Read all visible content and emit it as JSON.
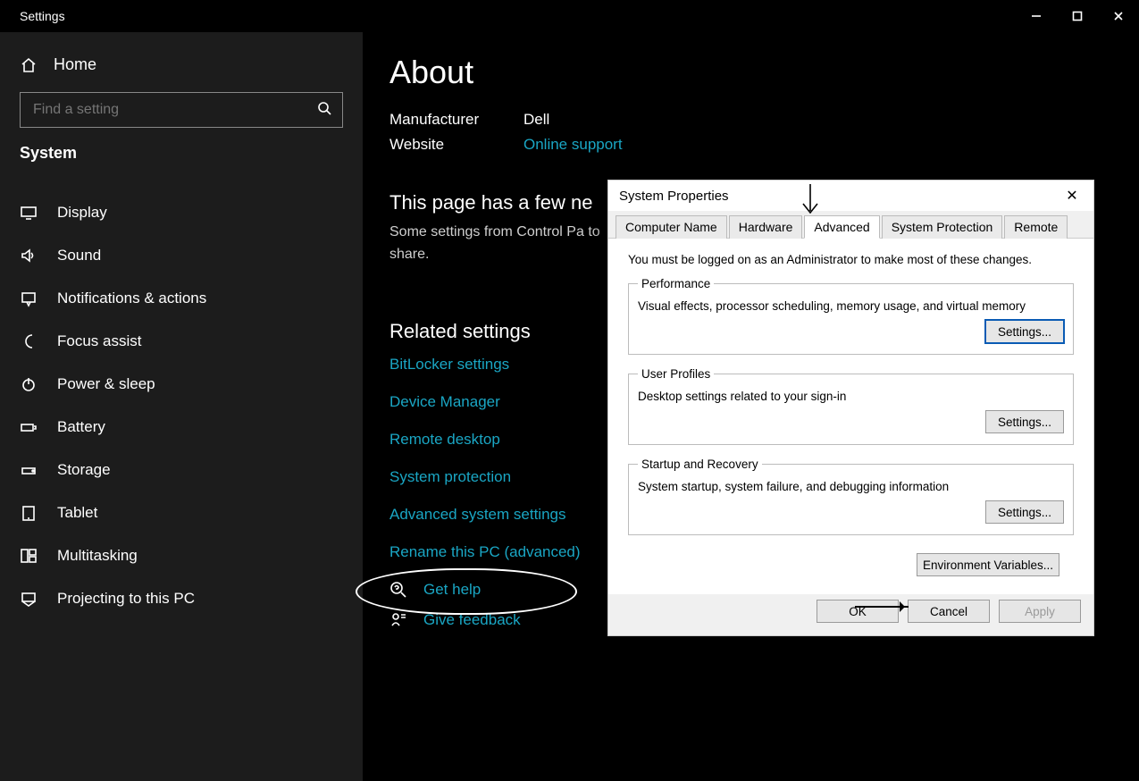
{
  "window": {
    "title": "Settings"
  },
  "sidebar": {
    "home_label": "Home",
    "search_placeholder": "Find a setting",
    "category": "System",
    "items": [
      {
        "label": "Display",
        "icon": "display-icon"
      },
      {
        "label": "Sound",
        "icon": "speaker-icon"
      },
      {
        "label": "Notifications & actions",
        "icon": "notification-icon"
      },
      {
        "label": "Focus assist",
        "icon": "moon-icon"
      },
      {
        "label": "Power & sleep",
        "icon": "power-icon"
      },
      {
        "label": "Battery",
        "icon": "battery-icon"
      },
      {
        "label": "Storage",
        "icon": "storage-icon"
      },
      {
        "label": "Tablet",
        "icon": "tablet-icon"
      },
      {
        "label": "Multitasking",
        "icon": "multitask-icon"
      },
      {
        "label": "Projecting to this PC",
        "icon": "project-icon"
      }
    ]
  },
  "page": {
    "title": "About",
    "manufacturer_label": "Manufacturer",
    "manufacturer": "Dell",
    "website_label": "Website",
    "website": "Online support",
    "few_heading": "This page has a few ne",
    "few_body": "Some settings from Control Pa to share.",
    "related_heading": "Related settings",
    "related": [
      "BitLocker settings",
      "Device Manager",
      "Remote desktop",
      "System protection",
      "Advanced system settings",
      "Rename this PC (advanced)"
    ],
    "help": "Get help",
    "feedback": "Give feedback"
  },
  "dialog": {
    "title": "System Properties",
    "tabs": [
      "Computer Name",
      "Hardware",
      "Advanced",
      "System Protection",
      "Remote"
    ],
    "note": "You must be logged on as an Administrator to make most of these changes.",
    "groups": {
      "performance": {
        "legend": "Performance",
        "desc": "Visual effects, processor scheduling, memory usage, and virtual memory",
        "button": "Settings..."
      },
      "profiles": {
        "legend": "User Profiles",
        "desc": "Desktop settings related to your sign-in",
        "button": "Settings..."
      },
      "startup": {
        "legend": "Startup and Recovery",
        "desc": "System startup, system failure, and debugging information",
        "button": "Settings..."
      }
    },
    "env_button": "Environment Variables...",
    "buttons": {
      "ok": "OK",
      "cancel": "Cancel",
      "apply": "Apply"
    }
  }
}
